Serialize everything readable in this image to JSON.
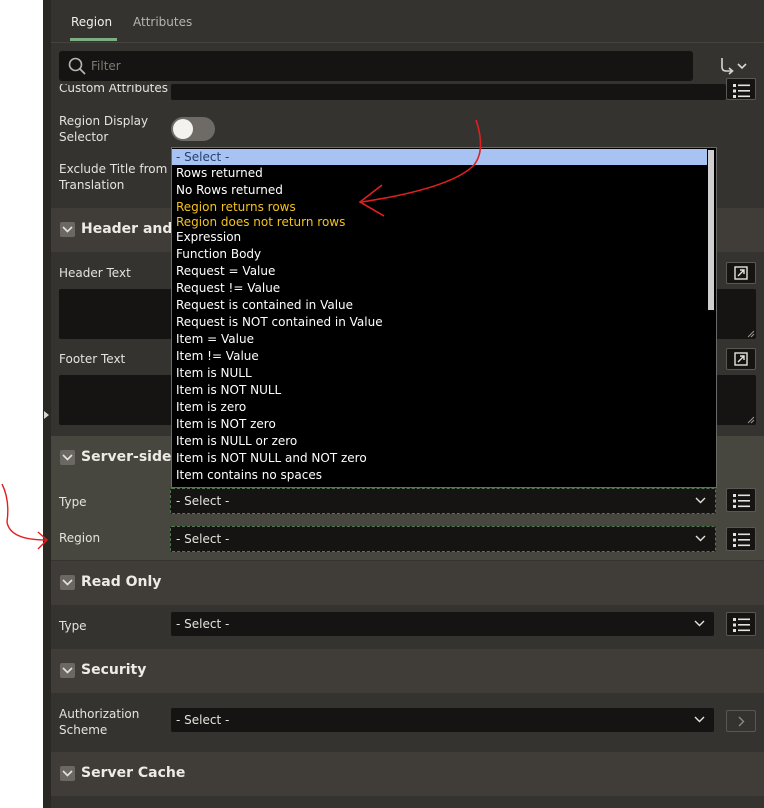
{
  "tabs": [
    {
      "label": "Region",
      "active": true
    },
    {
      "label": "Attributes",
      "active": false
    }
  ],
  "filter": {
    "placeholder": "Filter"
  },
  "fields": {
    "custom_attributes": "Custom Attributes",
    "region_display_selector": "Region Display Selector",
    "exclude_title_translation": "Exclude Title from Translation",
    "header_text": "Header Text",
    "footer_text": "Footer Text"
  },
  "sections": {
    "header_footer": "Header and Fo",
    "server_side": "Server-side Co",
    "read_only": "Read Only",
    "security": "Security",
    "server_cache": "Server Cache"
  },
  "server_side": {
    "type_label": "Type",
    "type_value": "- Select -",
    "region_label": "Region",
    "region_value": "- Select -"
  },
  "read_only": {
    "type_label": "Type",
    "type_value": "- Select -"
  },
  "security": {
    "auth_label": "Authorization Scheme",
    "auth_value": "- Select -"
  },
  "dropdown": {
    "items": [
      "- Select -",
      "Rows returned",
      "No Rows returned",
      "Region returns rows",
      "Region does not return rows",
      "Expression",
      "Function Body",
      "Request = Value",
      "Request != Value",
      "Request is contained in Value",
      "Request is NOT contained in Value",
      "Item = Value",
      "Item != Value",
      "Item is NULL",
      "Item is NOT NULL",
      "Item is zero",
      "Item is NOT zero",
      "Item is NULL or zero",
      "Item is NOT NULL and NOT zero",
      "Item contains no spaces"
    ],
    "selected_index": 0,
    "highlighted_indices": [
      3,
      4
    ]
  },
  "colors": {
    "panel": "#35332f",
    "input": "#151412",
    "accent": "#7fae84",
    "highlight_text": "#f4c21c",
    "selected_bg": "#a8c3f2",
    "annotation": "#e02020"
  },
  "icons": [
    "search-icon",
    "goto-group-icon",
    "chevron-down-icon",
    "list-icon",
    "popout-icon",
    "chevron-right-icon"
  ]
}
